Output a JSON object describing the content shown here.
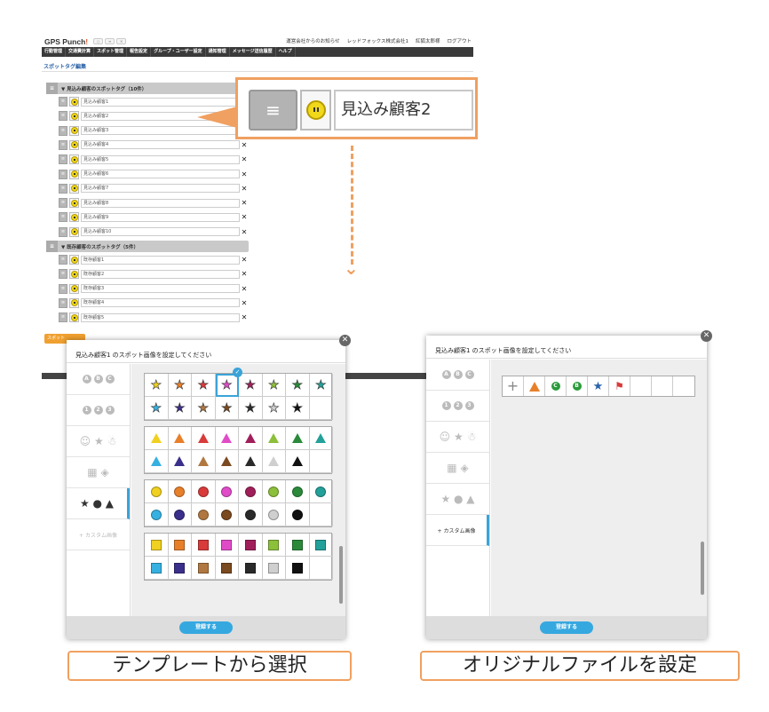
{
  "app": {
    "logo": "GPS Punch",
    "logo_mark": "!",
    "tab_buttons": [
      "○",
      "≡",
      "×"
    ],
    "toplinks": [
      "運営会社からのお知らせ",
      "レッドフォックス株式会社1",
      "紅狐太郎様",
      "ログアウト"
    ],
    "nav": [
      "行動管理",
      "交通費計算",
      "スポット管理",
      "報告設定",
      "グループ・ユーザー設定",
      "通知管理",
      "メッセージ送信履歴",
      "ヘルプ"
    ],
    "page_title": "スポットタグ編集",
    "group1": "▼ 見込み顧客のスポットタグ（10件）",
    "group1_items": [
      "見込み顧客1",
      "見込み顧客2",
      "見込み顧客3",
      "見込み顧客4",
      "見込み顧客5",
      "見込み顧客6",
      "見込み顧客7",
      "見込み顧客8",
      "見込み顧客9",
      "見込み顧客10"
    ],
    "group2": "▼ 既存顧客のスポットタグ（5件）",
    "group2_items": [
      "既存顧客1",
      "既存顧客2",
      "既存顧客3",
      "既存顧客4",
      "既存顧客5"
    ],
    "bottom_button": "スポット",
    "delete_label": "✕"
  },
  "zoom": {
    "handle": "≡",
    "value": "見込み顧客2"
  },
  "dialog_left": {
    "title": "見込み顧客1 のスポット画像を設定してください",
    "close": "✕",
    "custom": "+ カスタム画像",
    "register": "登録する",
    "side_glyphs": [
      [
        "A",
        "B",
        "C"
      ],
      [
        "1",
        "2",
        "3"
      ],
      [
        "☺",
        "★",
        "☃"
      ],
      [
        "▦",
        "◈"
      ],
      [
        "★",
        "●",
        "▲"
      ]
    ],
    "check": "✓"
  },
  "dialog_right": {
    "title": "見込み顧客1 のスポット画像を設定してください",
    "close": "✕",
    "custom": "+ カスタム画像",
    "register": "登録する",
    "add": "+",
    "thumbs": [
      "!",
      "C",
      "B",
      "★",
      "⚑"
    ]
  },
  "captions": {
    "left": "テンプレートから選択",
    "right": "オリジナルファイルを設定"
  },
  "colors": {
    "accent": "#f0a060",
    "primary": "#36a8e0",
    "nav": "#3a3a3a"
  },
  "palette": [
    "#f0d020",
    "#e8802a",
    "#d93a3a",
    "#e04cc8",
    "#a01f5a",
    "#8cbf3a",
    "#2a8a3a",
    "#23a09a",
    "#36b0e0",
    "#3a2f8a",
    "#b07840",
    "#7a4a20",
    "#2a2a2a",
    "#cfcfcf",
    "#111111"
  ]
}
